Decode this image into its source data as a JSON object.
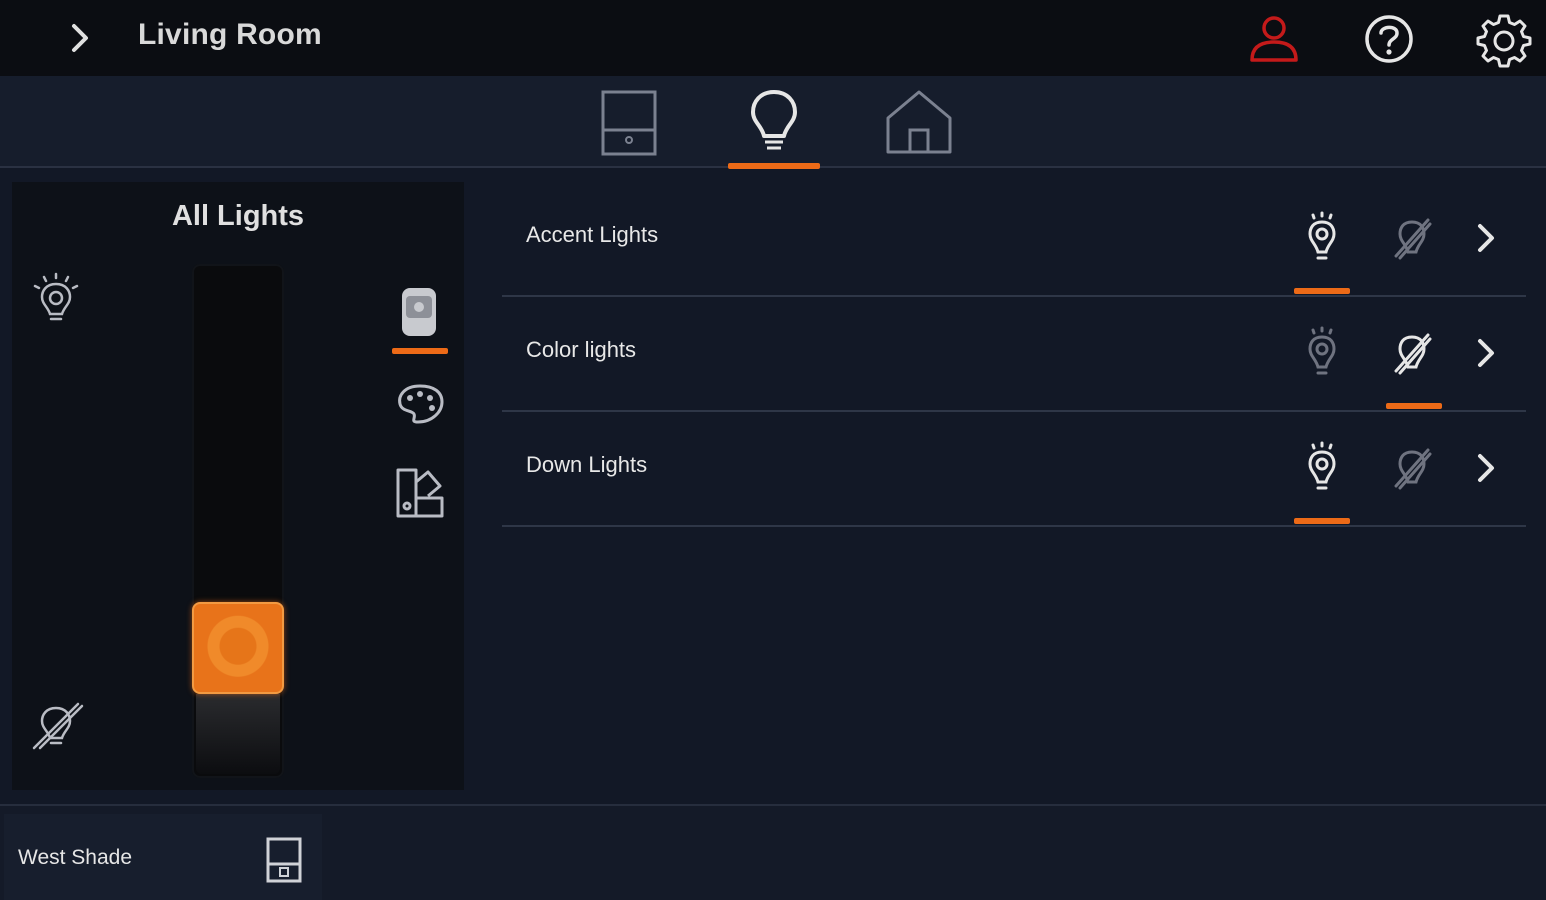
{
  "header": {
    "title": "Living Room",
    "icons": [
      "chevron-right-icon",
      "user-icon",
      "help-icon",
      "gear-icon"
    ],
    "user_icon_color": "#c41a1a"
  },
  "tabs": [
    {
      "name": "shades",
      "icon": "shade-icon",
      "active": false
    },
    {
      "name": "lights",
      "icon": "lightbulb-icon",
      "active": true
    },
    {
      "name": "home",
      "icon": "home-icon",
      "active": false
    }
  ],
  "master": {
    "title": "All Lights",
    "level_fraction": 0.2,
    "modes": [
      "dimmer-mode-icon",
      "color-palette-icon",
      "scene-swatch-icon"
    ],
    "active_mode": "dimmer-mode-icon"
  },
  "lights": [
    {
      "label": "Accent Lights",
      "state": "on"
    },
    {
      "label": "Color lights",
      "state": "off"
    },
    {
      "label": "Down Lights",
      "state": "on"
    }
  ],
  "footer": {
    "shade_label": "West Shade"
  },
  "colors": {
    "accent": "#ec6a17",
    "background": "#121826",
    "topbar": "#0b0d12"
  }
}
